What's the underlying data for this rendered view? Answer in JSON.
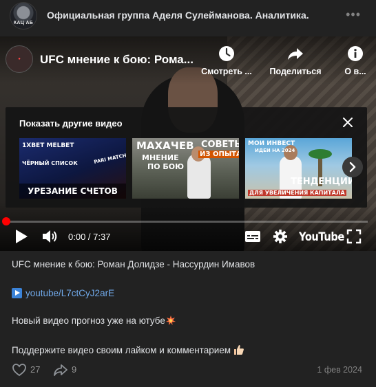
{
  "post": {
    "group_name": "Официальная группа Аделя Сулейманова. Аналитика.",
    "avatar_label": "КАЦ АБ",
    "more_icon": "more-horizontal-icon"
  },
  "video": {
    "title": "UFC мнение к бою: Рома...",
    "logo_icon": "channel-logo-icon",
    "actions": {
      "watch_later": "Смотреть ...",
      "share": "Поделиться",
      "about": "О в..."
    },
    "more_videos": {
      "title": "Показать другие видео",
      "thumbnails": [
        {
          "top": "1XBET  MELBET",
          "red": "ЧЁРНЫЙ СПИСОК",
          "mid": "PARI MATCH",
          "bottom": "УРЕЗАНИЕ СЧЕТОВ"
        },
        {
          "a": "МАХАЧЕВ",
          "b": "МНЕНИЕ",
          "c": "ПО БОЮ",
          "d": "СОВЕТЫ",
          "e": "ИЗ ОПЫТА"
        },
        {
          "a": "МОИ ИНВЕСТ",
          "b": "ИДЕИ НА 2024",
          "c": "ТЕНДЕНЦИИ",
          "d": "ДЛЯ УВЕЛИЧЕНИЯ КАПИТАЛА"
        }
      ]
    },
    "progress": 0,
    "time": "0:00 / 7:37",
    "brand": "YouTube",
    "accent_color": "#ff0000"
  },
  "body": {
    "line1": "UFC мнение к бою: Роман Долидзе - Нассурдин Имавов",
    "link": "youtube/L7ctCyJ2arE",
    "line3": "Новый видео прогноз уже на ютубе",
    "line4": "Поддержите видео своим лайком и комментарием"
  },
  "footer": {
    "likes": "27",
    "shares": "9",
    "date": "1 фев 2024"
  }
}
